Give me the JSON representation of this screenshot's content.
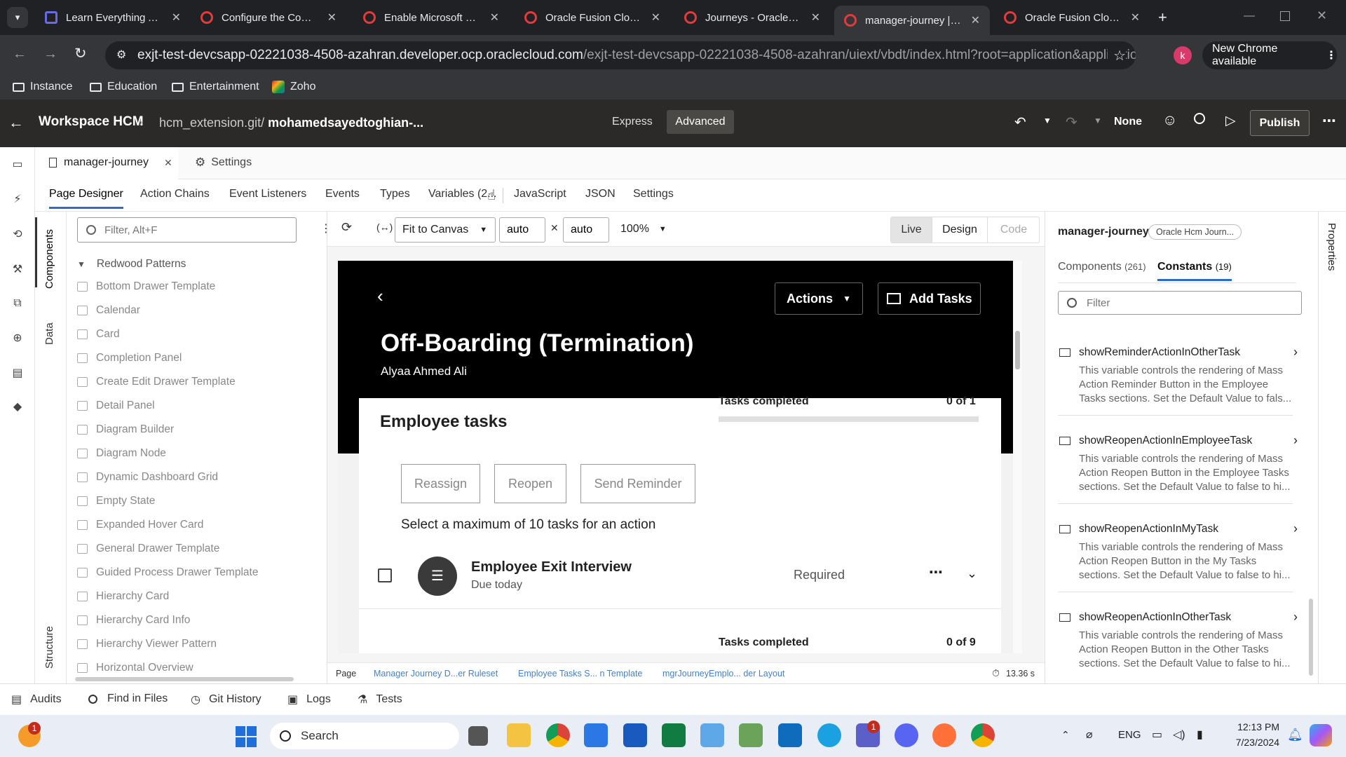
{
  "browser": {
    "tabs": [
      {
        "title": "Learn Everything Abo",
        "active": false
      },
      {
        "title": "Configure the Conter",
        "active": false
      },
      {
        "title": "Enable Microsoft Offi",
        "active": false
      },
      {
        "title": "Oracle Fusion Cloud",
        "active": false
      },
      {
        "title": "Journeys - Oracle Fu",
        "active": false
      },
      {
        "title": "manager-journey | Vi",
        "active": true
      },
      {
        "title": "Oracle Fusion Cloud",
        "active": false
      }
    ],
    "url_host": "exjt-test-devcsapp-02221038-4508-azahran.developer.ocp.oraclecloud.com",
    "url_path": "/exjt-test-devcsapp-02221038-4508-azahran/uiext/vbdt/index.html?root=application&application=exjt-t...",
    "profile_initial": "k",
    "update_label": "New Chrome available",
    "bookmarks": [
      "Instance",
      "Education",
      "Entertainment",
      "Zoho"
    ]
  },
  "header": {
    "app": "Workspace HCM",
    "repo": "hcm_extension.git/",
    "branch": "mohamedsayedtoghian-...",
    "mode_express": "Express",
    "mode_advanced": "Advanced",
    "profile": "None",
    "publish": "Publish"
  },
  "file_tabs": {
    "active": "manager-journey",
    "settings": "Settings"
  },
  "sub_tabs": [
    "Page Designer",
    "Action Chains",
    "Event Listeners",
    "Events",
    "Types",
    "Variables (2...",
    "JavaScript",
    "JSON",
    "Settings"
  ],
  "side_rail": {
    "components": "Components",
    "data": "Data",
    "structure": "Structure"
  },
  "components": {
    "filter_placeholder": "Filter, Alt+F",
    "group": "Redwood Patterns",
    "items": [
      "Bottom Drawer Template",
      "Calendar",
      "Card",
      "Completion Panel",
      "Create Edit Drawer Template",
      "Detail Panel",
      "Diagram Builder",
      "Diagram Node",
      "Dynamic Dashboard Grid",
      "Empty State",
      "Expanded Hover Card",
      "General Drawer Template",
      "Guided Process Drawer Template",
      "Hierarchy Card",
      "Hierarchy Card Info",
      "Hierarchy Viewer Pattern",
      "Horizontal Overview"
    ]
  },
  "canvas_toolbar": {
    "fit": "Fit to Canvas",
    "width": "auto",
    "height": "auto",
    "zoom": "100%",
    "live": "Live",
    "design": "Design",
    "code": "Code"
  },
  "preview": {
    "actions": "Actions",
    "add_tasks": "Add Tasks",
    "title": "Off-Boarding (Termination)",
    "person": "Alyaa Ahmed Ali",
    "tasks_completed_label": "Tasks completed",
    "tasks_completed_1": "0 of 1",
    "section_title": "Employee tasks",
    "reassign": "Reassign",
    "reopen": "Reopen",
    "send_reminder": "Send Reminder",
    "select_hint": "Select a maximum of 10 tasks for an action",
    "task_name": "Employee Exit Interview",
    "task_due": "Due today",
    "task_status": "Required",
    "tasks_completed_2": "0 of 9"
  },
  "status_bar": {
    "crumbs": [
      "Page",
      "Manager Journey D...er Ruleset",
      "Employee Tasks S... n Template",
      "mgrJourneyEmplo... der Layout"
    ],
    "timer": "13.36 s"
  },
  "right_panel": {
    "page_name": "manager-journey",
    "badge": "Oracle Hcm Journ...",
    "tab_components": "Components",
    "tab_components_count": "(261)",
    "tab_constants": "Constants",
    "tab_constants_count": "(19)",
    "filter_placeholder": "Filter",
    "properties": "Properties",
    "variables": [
      {
        "name": "showReminderActionInOtherTask",
        "desc": "This variable controls the rendering of Mass Action Reminder Button in the Employee Tasks sections. Set the Default Value to fals..."
      },
      {
        "name": "showReopenActionInEmployeeTask",
        "desc": "This variable controls the rendering of Mass Action Reopen Button in the Employee Tasks sections. Set the Default Value to false to hi..."
      },
      {
        "name": "showReopenActionInMyTask",
        "desc": "This variable controls the rendering of Mass Action Reopen Button in the My Tasks sections. Set the Default Value to false to hi..."
      },
      {
        "name": "showReopenActionInOtherTask",
        "desc": "This variable controls the rendering of Mass Action Reopen Button in the Other Tasks sections. Set the Default Value to false to hi..."
      }
    ]
  },
  "bottom_tools": [
    "Audits",
    "Find in Files",
    "Git History",
    "Logs",
    "Tests"
  ],
  "taskbar": {
    "search": "Search",
    "lang": "ENG",
    "time": "12:13 PM",
    "date": "7/23/2024",
    "weather_badge": "1",
    "teams_badge": "1"
  }
}
